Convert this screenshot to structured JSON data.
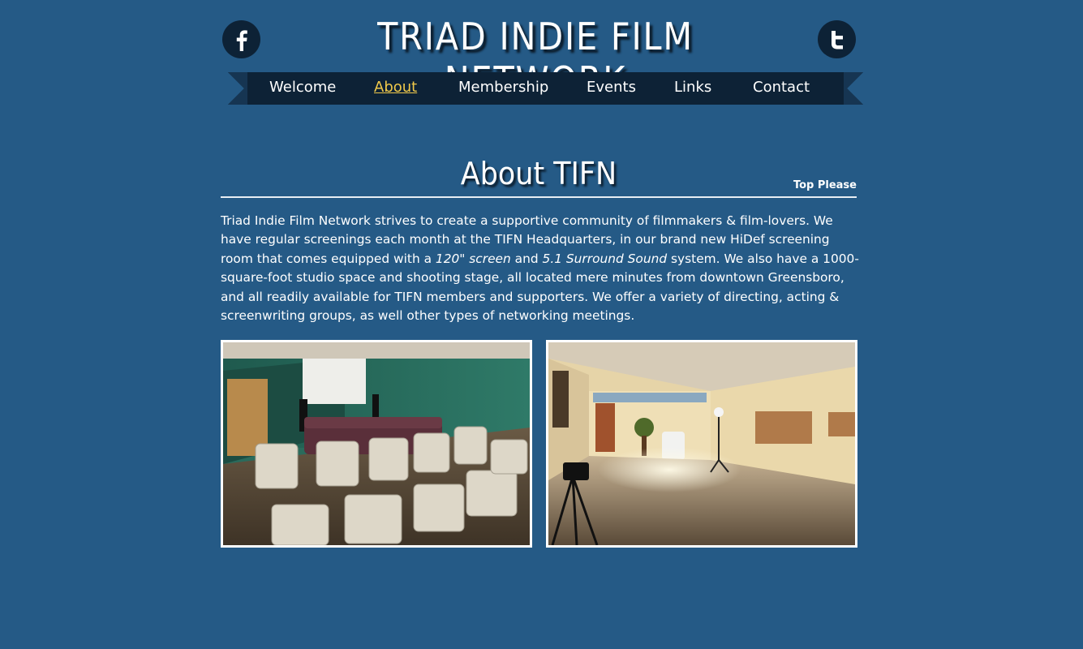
{
  "header": {
    "title": "TRIAD INDIE FILM NETWORK",
    "social": [
      {
        "name": "facebook",
        "icon": "facebook-icon"
      },
      {
        "name": "twitter",
        "icon": "twitter-icon"
      }
    ]
  },
  "nav": {
    "items": [
      {
        "label": "Welcome"
      },
      {
        "label": "About",
        "active": true
      },
      {
        "label": "Membership"
      },
      {
        "label": "Events"
      },
      {
        "label": "Links"
      },
      {
        "label": "Contact"
      }
    ]
  },
  "section": {
    "title": "About TIFN",
    "top_link": "Top Please"
  },
  "intro": {
    "part1": "Triad Indie Film Network strives to create a supportive community of filmmakers & film-lovers. We have regular screenings each month at the TIFN Headquarters, in our brand new HiDef screening room that comes equipped with a ",
    "em1": "120\" screen",
    "part2": " and ",
    "em2": "5.1 Surround Sound",
    "part3": " system. We also have a 1000-square-foot studio space and shooting stage, all located mere minutes from downtown Greensboro, and all readily available for TIFN members and supporters. We offer a variety of directing, acting & screenwriting groups, as well other types of networking meetings."
  },
  "photos": [
    {
      "subject": "screening-room-photo"
    },
    {
      "subject": "studio-space-photo"
    }
  ],
  "colors": {
    "background": "#255a86",
    "nav_bar": "#0d2236",
    "nav_active": "#f0c94a"
  }
}
